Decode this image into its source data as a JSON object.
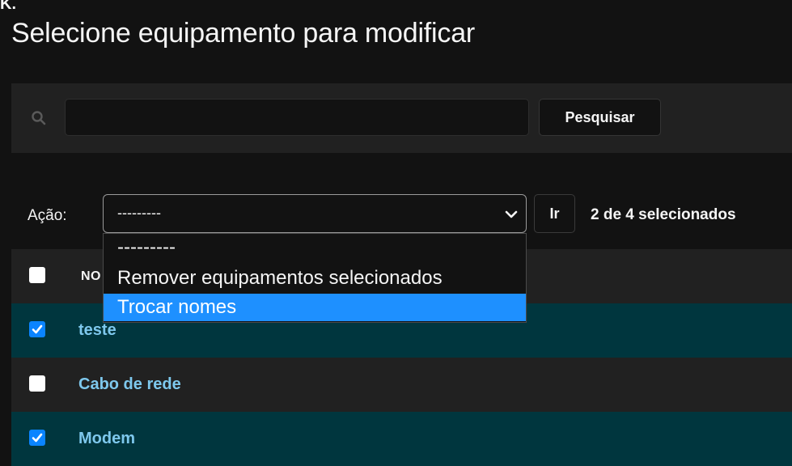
{
  "top_fragment": "K.",
  "page": {
    "title": "Selecione equipamento para modificar"
  },
  "search": {
    "placeholder": "",
    "value": "",
    "button_label": "Pesquisar"
  },
  "actions": {
    "label": "Ação:",
    "selected": "---------",
    "options": [
      "---------",
      "Remover equipamentos selecionados",
      "Trocar nomes"
    ],
    "highlighted_option": "Trocar nomes",
    "go_label": "Ir",
    "selection_count": "2 de 4 selecionados"
  },
  "table": {
    "column_header_visible": "NO",
    "rows": [
      {
        "name": "teste",
        "checked": true
      },
      {
        "name": "Cabo de rede",
        "checked": false
      },
      {
        "name": "Modem",
        "checked": true
      }
    ]
  },
  "colors": {
    "background": "#121212",
    "bar": "#212121",
    "selected_row": "#00363e",
    "link": "#7ec8ed",
    "checkbox_checked": "#0a84ff",
    "dropdown_highlight": "#1e90ff"
  }
}
